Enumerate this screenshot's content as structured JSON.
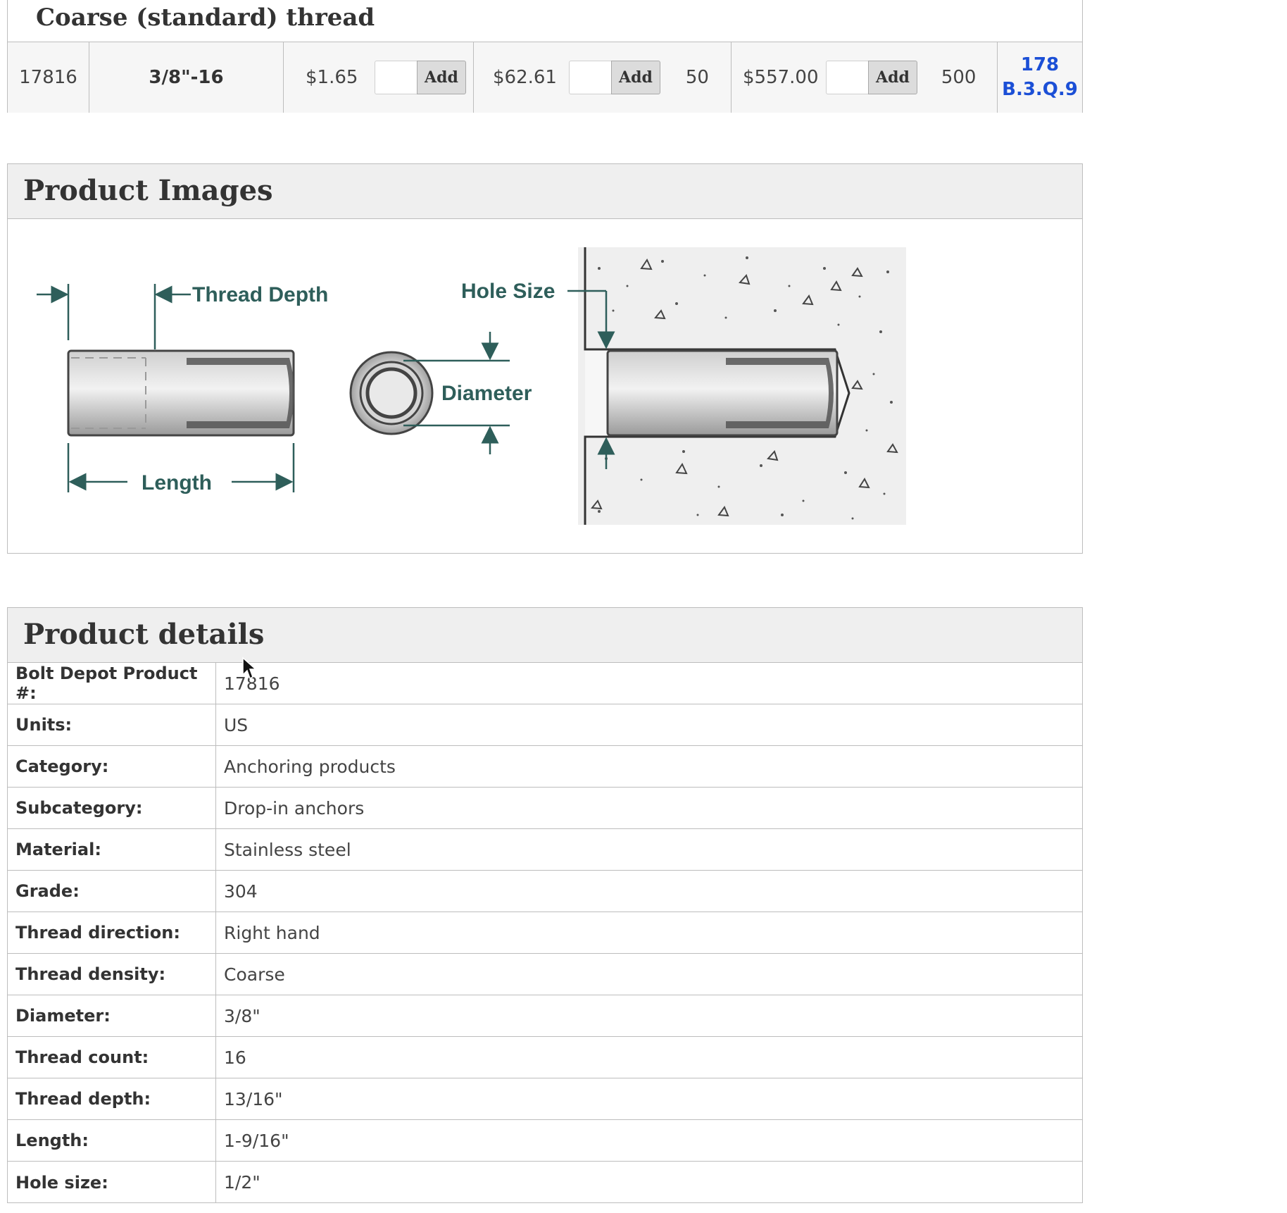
{
  "price_table": {
    "group_title": "Coarse (standard) thread",
    "row": {
      "product_number": "17816",
      "size": "3/8\"-16",
      "unit_price": "$1.65",
      "pack_price": "$62.61",
      "pack_qty": "50",
      "bulk_price": "$557.00",
      "bulk_qty": "500",
      "location_line1": "178",
      "location_line2": "B.3.Q.9"
    },
    "add_label": "Add"
  },
  "product_images": {
    "title": "Product Images",
    "diagram_labels": {
      "thread_depth": "Thread Depth",
      "hole_size": "Hole Size",
      "diameter": "Diameter",
      "length": "Length"
    }
  },
  "product_details": {
    "title": "Product details",
    "rows": [
      {
        "label": "Bolt Depot Product #:",
        "value": "17816"
      },
      {
        "label": "Units:",
        "value": "US"
      },
      {
        "label": "Category:",
        "value": "Anchoring products"
      },
      {
        "label": "Subcategory:",
        "value": "Drop-in anchors"
      },
      {
        "label": "Material:",
        "value": "Stainless steel"
      },
      {
        "label": "Grade:",
        "value": "304"
      },
      {
        "label": "Thread direction:",
        "value": "Right hand"
      },
      {
        "label": "Thread density:",
        "value": "Coarse"
      },
      {
        "label": "Diameter:",
        "value": "3/8\""
      },
      {
        "label": "Thread count:",
        "value": "16"
      },
      {
        "label": "Thread depth:",
        "value": "13/16\""
      },
      {
        "label": "Length:",
        "value": "1-9/16\""
      },
      {
        "label": "Hole size:",
        "value": "1/2\""
      }
    ]
  },
  "colors": {
    "link": "#1b4fd6",
    "diagram_teal": "#2e5e5a",
    "header_bg": "#efefef",
    "border": "#bdbdbd"
  }
}
